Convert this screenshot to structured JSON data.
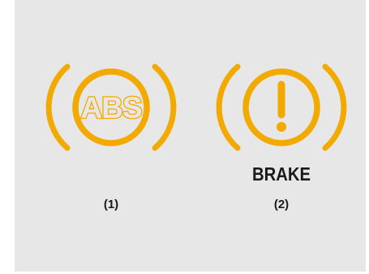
{
  "colors": {
    "panel_background": "#e7e7e8",
    "indicator_amber": "#f2a900",
    "text": "#1a1a1a"
  },
  "indicators": [
    {
      "icon": "abs-warning-icon",
      "symbol_text": "ABS",
      "caption": "",
      "label": "(1)"
    },
    {
      "icon": "brake-warning-icon",
      "symbol_text": "!",
      "caption": "BRAKE",
      "label": "(2)"
    }
  ]
}
